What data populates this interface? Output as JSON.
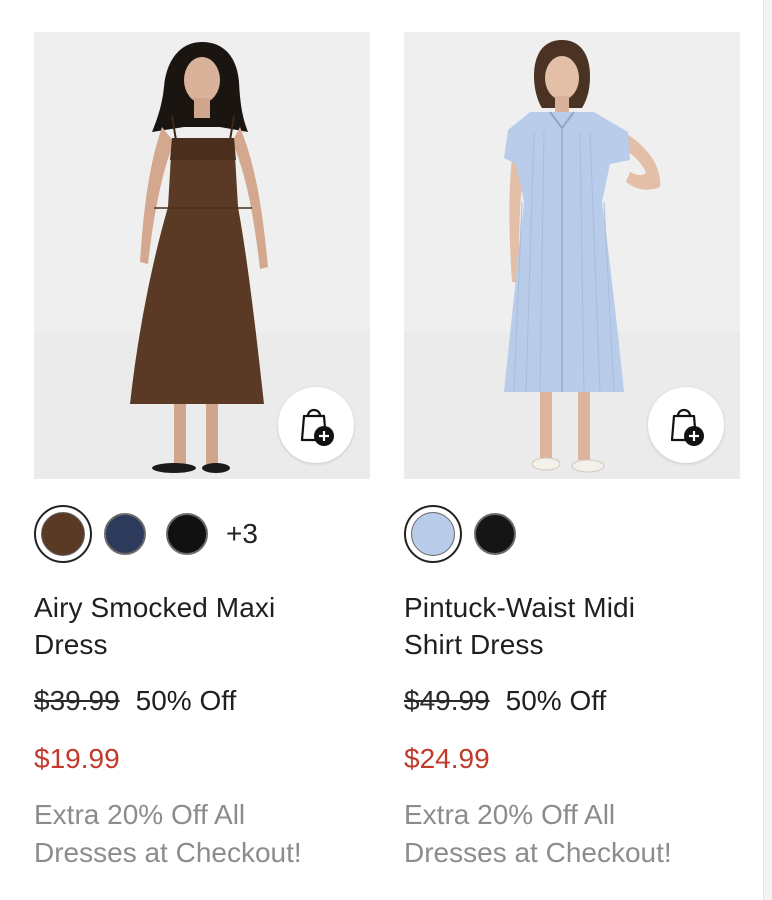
{
  "products": [
    {
      "name": "Airy Smocked Maxi Dress",
      "name_line1": "Airy Smocked Maxi",
      "name_line2": "Dress",
      "original_price": "$39.99",
      "discount": "50% Off",
      "sale_price": "$19.99",
      "promo_line1": "Extra 20% Off All",
      "promo_line2": "Dresses at Checkout!",
      "swatches": [
        {
          "color": "#5a3a24",
          "selected": true
        },
        {
          "color": "#2e3a5c",
          "selected": false
        },
        {
          "color": "#111111",
          "selected": false
        }
      ],
      "more_colors": "+3",
      "bag_icon": "add-to-bag-icon"
    },
    {
      "name": "Pintuck-Waist Midi Shirt Dress",
      "name_line1": "Pintuck-Waist Midi",
      "name_line2": "Shirt Dress",
      "original_price": "$49.99",
      "discount": "50% Off",
      "sale_price": "$24.99",
      "promo_line1": "Extra 20% Off All",
      "promo_line2": "Dresses at Checkout!",
      "swatches": [
        {
          "color": "#b9cdea",
          "selected": true
        },
        {
          "color": "#151515",
          "selected": false
        }
      ],
      "bag_icon": "add-to-bag-icon"
    }
  ],
  "colors": {
    "sale_red": "#c23a2b",
    "promo_gray": "#8c8c8c",
    "image_bg": "#eeeeee"
  }
}
